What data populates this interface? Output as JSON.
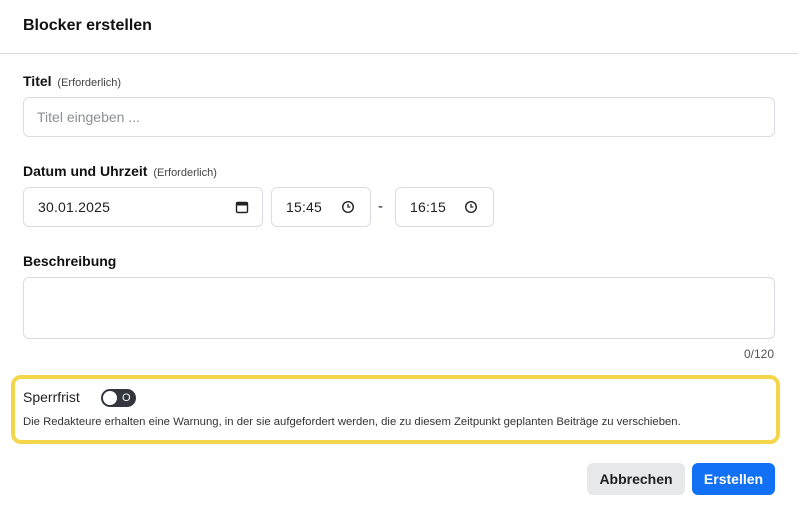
{
  "dialog": {
    "title": "Blocker erstellen"
  },
  "title_field": {
    "label": "Titel",
    "required": "(Erforderlich)",
    "placeholder": "Titel eingeben ..."
  },
  "datetime": {
    "label": "Datum und Uhrzeit",
    "required": "(Erforderlich)",
    "date": "30.01.2025",
    "start_time": "15:45",
    "separator": "-",
    "end_time": "16:15",
    "date_icon": "calendar-icon",
    "time_icon": "clock-icon"
  },
  "description": {
    "label": "Beschreibung",
    "value": "",
    "counter": "0/120"
  },
  "sperrfrist": {
    "label": "Sperrfrist",
    "toggle_state": "O",
    "toggle_on": false,
    "hint": "Die Redakteure erhalten eine Warnung, in der sie aufgefordert werden, die zu diesem Zeitpunkt geplanten Beiträge zu verschieben.",
    "highlight_color": "#f3d64a"
  },
  "actions": {
    "cancel": "Abbrechen",
    "submit": "Erstellen",
    "primary_color": "#1270f5"
  }
}
